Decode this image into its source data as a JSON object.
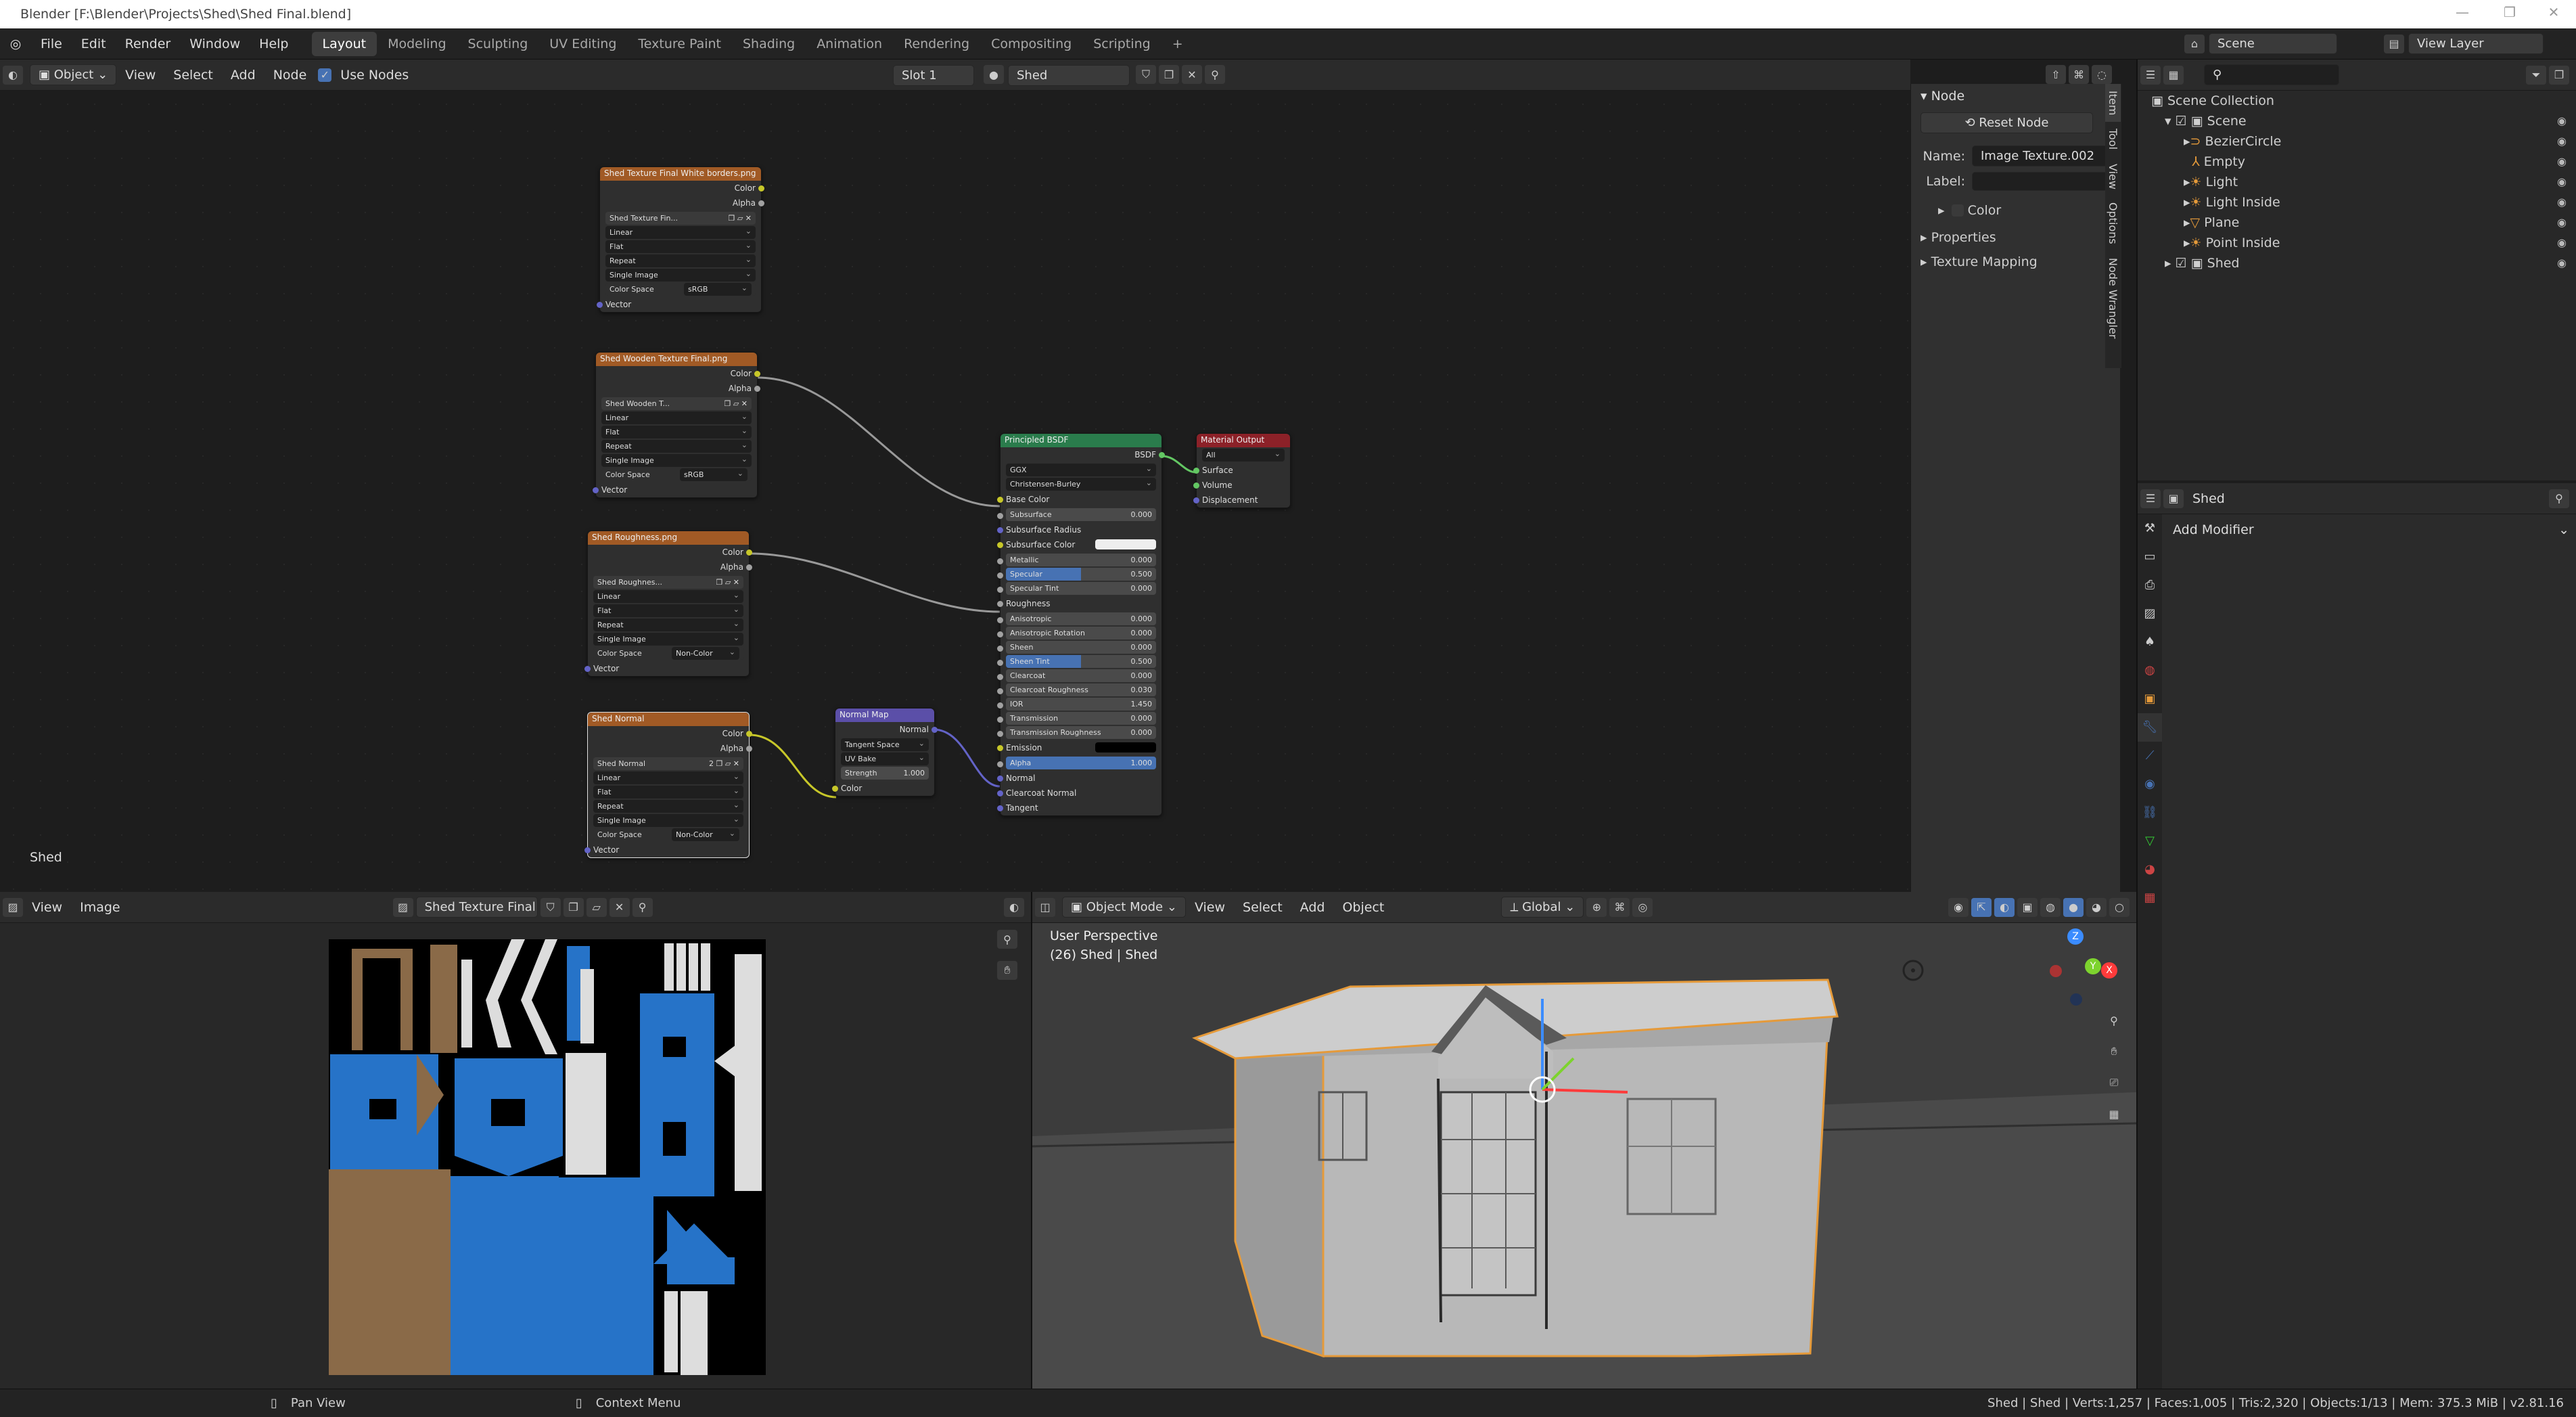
{
  "window": {
    "title": "Blender [F:\\Blender\\Projects\\Shed\\Shed Final.blend]"
  },
  "menu": [
    "File",
    "Edit",
    "Render",
    "Window",
    "Help"
  ],
  "workspaces": [
    "Layout",
    "Modeling",
    "Sculpting",
    "UV Editing",
    "Texture Paint",
    "Shading",
    "Animation",
    "Rendering",
    "Compositing",
    "Scripting"
  ],
  "scene_label": "Scene",
  "view_layer_label": "View Layer",
  "node_header": {
    "mode": "Object",
    "menus": [
      "View",
      "Select",
      "Add",
      "Node"
    ],
    "use_nodes": "Use Nodes",
    "slot": "Slot 1",
    "material": "Shed"
  },
  "node_editor": {
    "context_label": "Shed"
  },
  "nodes": {
    "tex1": {
      "title": "Shed Texture Final White borders.png",
      "img": "Shed Texture Fin...",
      "opts": [
        "Linear",
        "Flat",
        "Repeat",
        "Single Image"
      ],
      "cs_label": "Color Space",
      "cs": "sRGB"
    },
    "tex2": {
      "title": "Shed Wooden Texture Final.png",
      "img": "Shed Wooden T...",
      "opts": [
        "Linear",
        "Flat",
        "Repeat",
        "Single Image"
      ],
      "cs_label": "Color Space",
      "cs": "sRGB"
    },
    "tex3": {
      "title": "Shed Roughness.png",
      "img": "Shed Roughnes...",
      "opts": [
        "Linear",
        "Flat",
        "Repeat",
        "Single Image"
      ],
      "cs_label": "Color Space",
      "cs": "Non-Color"
    },
    "tex4": {
      "title": "Shed Normal",
      "img": "Shed Normal",
      "users": "2",
      "opts": [
        "Linear",
        "Flat",
        "Repeat",
        "Single Image"
      ],
      "cs_label": "Color Space",
      "cs": "Non-Color"
    },
    "sock": {
      "color": "Color",
      "alpha": "Alpha",
      "vector": "Vector"
    },
    "normal_map": {
      "title": "Normal Map",
      "out": "Normal",
      "space": "Tangent Space",
      "uv": "UV Bake",
      "strength_label": "Strength",
      "strength": "1.000",
      "in": "Color"
    },
    "bsdf": {
      "title": "Principled BSDF",
      "out": "BSDF",
      "dist": "GGX",
      "sss": "Christensen-Burley",
      "rows": [
        [
          "Base Color",
          ""
        ],
        [
          "Subsurface",
          "0.000"
        ],
        [
          "Subsurface Radius",
          ""
        ],
        [
          "Subsurface Color",
          ""
        ],
        [
          "Metallic",
          "0.000"
        ],
        [
          "Specular",
          "0.500"
        ],
        [
          "Specular Tint",
          "0.000"
        ],
        [
          "Roughness",
          ""
        ],
        [
          "Anisotropic",
          "0.000"
        ],
        [
          "Anisotropic Rotation",
          "0.000"
        ],
        [
          "Sheen",
          "0.000"
        ],
        [
          "Sheen Tint",
          "0.500"
        ],
        [
          "Clearcoat",
          "0.000"
        ],
        [
          "Clearcoat Roughness",
          "0.030"
        ],
        [
          "IOR",
          "1.450"
        ],
        [
          "Transmission",
          "0.000"
        ],
        [
          "Transmission Roughness",
          "0.000"
        ],
        [
          "Emission",
          ""
        ],
        [
          "Alpha",
          "1.000"
        ],
        [
          "Normal",
          ""
        ],
        [
          "Clearcoat Normal",
          ""
        ],
        [
          "Tangent",
          ""
        ]
      ]
    },
    "output": {
      "title": "Material Output",
      "target": "All",
      "sockets": [
        "Surface",
        "Volume",
        "Displacement"
      ]
    }
  },
  "sidebar": {
    "section": "Node",
    "reset": "Reset Node",
    "name_label": "Name:",
    "name": "Image Texture.002",
    "label_label": "Label:",
    "color": "Color",
    "properties": "Properties",
    "texture_mapping": "Texture Mapping",
    "tabs": [
      "Item",
      "Tool",
      "View",
      "Options",
      "Node Wrangler"
    ]
  },
  "outliner": {
    "root": "Scene Collection",
    "items": [
      "Scene",
      "BezierCircle",
      "Empty",
      "Light",
      "Light Inside",
      "Plane",
      "Point Inside",
      "Shed"
    ]
  },
  "properties": {
    "object": "Shed",
    "add_modifier": "Add Modifier"
  },
  "image_editor": {
    "menus": [
      "View",
      "Image"
    ],
    "image_name": "Shed Texture Final ..."
  },
  "viewport": {
    "mode": "Object Mode",
    "menus": [
      "View",
      "Select",
      "Add",
      "Object"
    ],
    "orientation": "Global",
    "perspective": "User Perspective",
    "object_info": "(26) Shed | Shed",
    "axes": {
      "x": "X",
      "y": "Y",
      "z": "Z"
    }
  },
  "status": {
    "pan": "Pan View",
    "context": "Context Menu",
    "stats": "Shed | Shed | Verts:1,257 | Faces:1,005 | Tris:2,320 | Objects:1/13 | Mem: 375.3 MiB | v2.81.16"
  },
  "colors": {
    "accent": "#4772b3",
    "texture_header": "#a15a25",
    "bsdf_header": "#2a7c4c",
    "output_header": "#8c2128",
    "vector_header": "#5b4fa8",
    "selection": "#e59a3a"
  }
}
